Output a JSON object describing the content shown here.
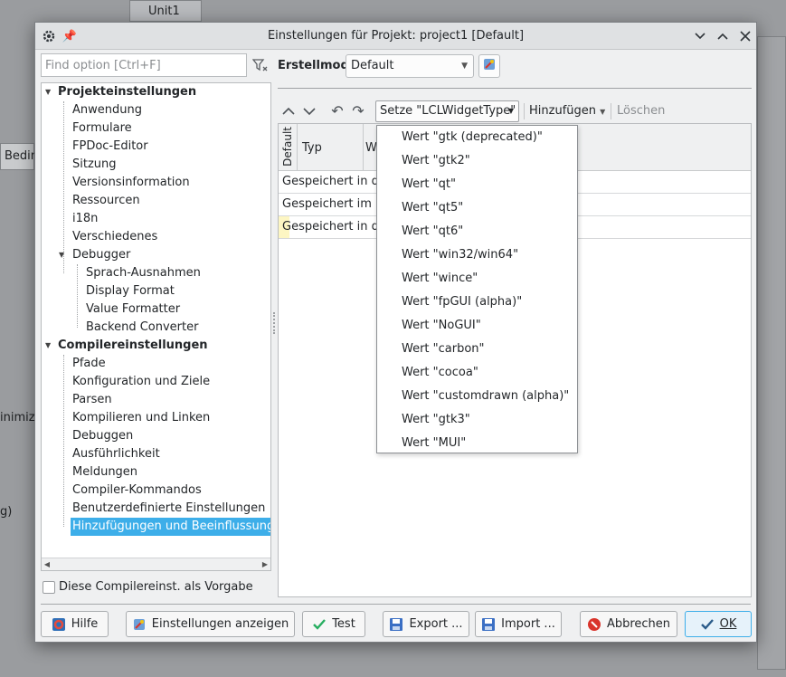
{
  "background": {
    "top_tab": "Unit1",
    "fragments": [
      "Bedin",
      "inimiz",
      "g)"
    ]
  },
  "dialog": {
    "title": "Einstellungen für Projekt: project1 [Default]"
  },
  "search": {
    "placeholder": "Find option [Ctrl+F]"
  },
  "buildmodes": {
    "label": "Erstellmodi",
    "selected": "Default"
  },
  "tree": {
    "items": [
      {
        "label": "Projekteinstellungen",
        "bold": true
      },
      {
        "label": "Anwendung"
      },
      {
        "label": "Formulare"
      },
      {
        "label": "FPDoc-Editor"
      },
      {
        "label": "Sitzung"
      },
      {
        "label": "Versionsinformation"
      },
      {
        "label": "Ressourcen"
      },
      {
        "label": "i18n"
      },
      {
        "label": "Verschiedenes"
      },
      {
        "label": "Debugger"
      },
      {
        "label": "Sprach-Ausnahmen"
      },
      {
        "label": "Display Format"
      },
      {
        "label": "Value Formatter"
      },
      {
        "label": "Backend Converter"
      },
      {
        "label": "Compilereinstellungen",
        "bold": true
      },
      {
        "label": "Pfade"
      },
      {
        "label": "Konfiguration und Ziele"
      },
      {
        "label": "Parsen"
      },
      {
        "label": "Kompilieren und Linken"
      },
      {
        "label": "Debuggen"
      },
      {
        "label": "Ausführlichkeit"
      },
      {
        "label": "Meldungen"
      },
      {
        "label": "Compiler-Kommandos"
      },
      {
        "label": "Benutzerdefinierte Einstellungen"
      },
      {
        "label": "Hinzufügungen und Beeinflussungen",
        "selected": true
      }
    ]
  },
  "default_checkbox": {
    "label": "Diese Compilereinst. als Vorgabe",
    "checked": false
  },
  "toolbar": {
    "set_button": "Setze \"LCLWidgetType\"",
    "add_button": "Hinzufügen",
    "delete_button": "Löschen"
  },
  "grid": {
    "headers": {
      "default": "Default",
      "type": "Typ",
      "value_partial": "W"
    },
    "rows": [
      "Gespeichert in de",
      "Gespeichert im Pr",
      "Gespeichert in de"
    ]
  },
  "menu": {
    "items": [
      "Wert \"gtk (deprecated)\"",
      "Wert \"gtk2\"",
      "Wert \"qt\"",
      "Wert \"qt5\"",
      "Wert \"qt6\"",
      "Wert \"win32/win64\"",
      "Wert \"wince\"",
      "Wert \"fpGUI (alpha)\"",
      "Wert \"NoGUI\"",
      "Wert \"carbon\"",
      "Wert \"cocoa\"",
      "Wert \"customdrawn (alpha)\"",
      "Wert \"gtk3\"",
      "Wert \"MUI\""
    ]
  },
  "buttons": {
    "help": "Hilfe",
    "show_options": "Einstellungen anzeigen",
    "test": "Test",
    "export": "Export ...",
    "import": "Import ...",
    "cancel": "Abbrechen",
    "ok": "OK"
  },
  "colors": {
    "selection": "#3daee9",
    "accent_ok": "#3daee9",
    "cancel_red": "#d9342b",
    "test_green": "#27ae60"
  }
}
